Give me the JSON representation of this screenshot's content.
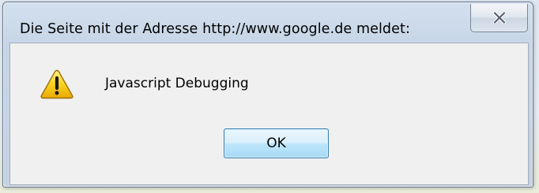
{
  "dialog": {
    "title": "Die Seite mit der Adresse http://www.google.de meldet:",
    "message": "Javascript Debugging",
    "ok_label": "OK",
    "close_icon": "close-icon",
    "warning_icon": "warning-icon"
  },
  "colors": {
    "client_background": "#f0f0f0",
    "frame": "#c6d5e6",
    "warning_yellow": "#f5c518",
    "ok_button_border": "#3c7fb1"
  }
}
